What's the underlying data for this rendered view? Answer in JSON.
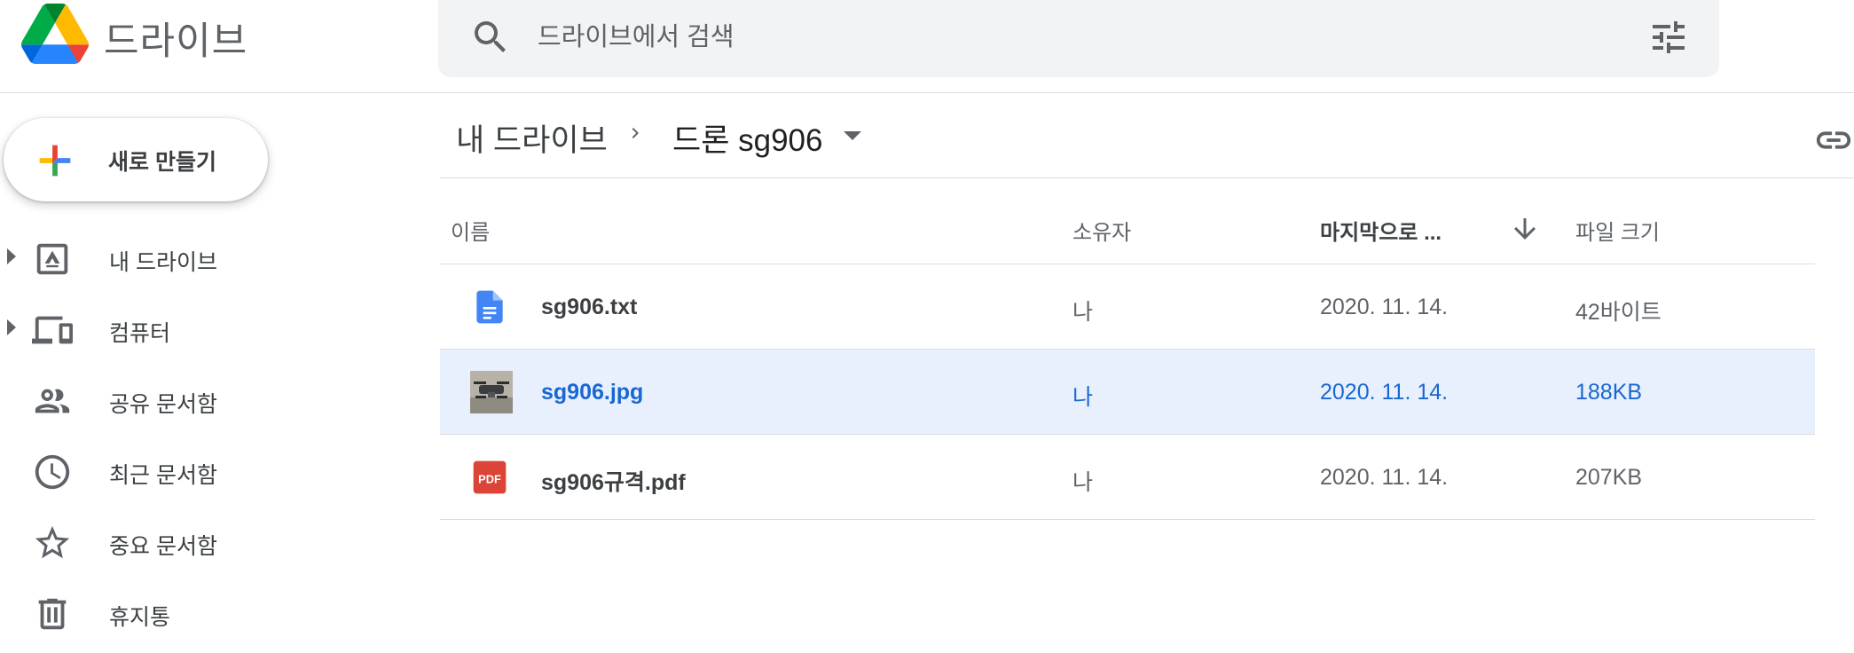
{
  "app": {
    "title": "드라이브",
    "logo_icon": "google-drive-logo"
  },
  "search": {
    "placeholder": "드라이브에서 검색",
    "value": "",
    "search_icon": "search-icon",
    "options_icon": "tune-icon"
  },
  "sidebar": {
    "new_button_label": "새로 만들기",
    "items": [
      {
        "label": "내 드라이브",
        "icon": "my-drive-icon",
        "expandable": true
      },
      {
        "label": "컴퓨터",
        "icon": "computers-icon",
        "expandable": true
      },
      {
        "label": "공유 문서함",
        "icon": "shared-people-icon",
        "expandable": false
      },
      {
        "label": "최근 문서함",
        "icon": "clock-icon",
        "expandable": false
      },
      {
        "label": "중요 문서함",
        "icon": "star-icon",
        "expandable": false
      },
      {
        "label": "휴지통",
        "icon": "trash-icon",
        "expandable": false
      }
    ]
  },
  "breadcrumb": {
    "root": "내 드라이브",
    "current": "드론 sg906"
  },
  "table": {
    "columns": {
      "name": "이름",
      "owner": "소유자",
      "modified": "마지막으로 ...",
      "size": "파일 크기"
    },
    "sort": {
      "column": "modified",
      "direction": "descending"
    },
    "rows": [
      {
        "name": "sg906.txt",
        "owner": "나",
        "modified": "2020. 11. 14.",
        "size": "42바이트",
        "type_icon": "document-icon",
        "selected": false
      },
      {
        "name": "sg906.jpg",
        "owner": "나",
        "modified": "2020. 11. 14.",
        "size": "188KB",
        "type_icon": "image-thumbnail",
        "selected": true
      },
      {
        "name": "sg906규격.pdf",
        "owner": "나",
        "modified": "2020. 11. 14.",
        "size": "207KB",
        "type_icon": "pdf-icon",
        "selected": false
      }
    ]
  },
  "colors": {
    "selected_row_bg": "#e8f0fe",
    "selected_text": "#1967d2",
    "doc_blue": "#4285f4",
    "pdf_red": "#db4437"
  },
  "pdf_icon_text": "PDF"
}
